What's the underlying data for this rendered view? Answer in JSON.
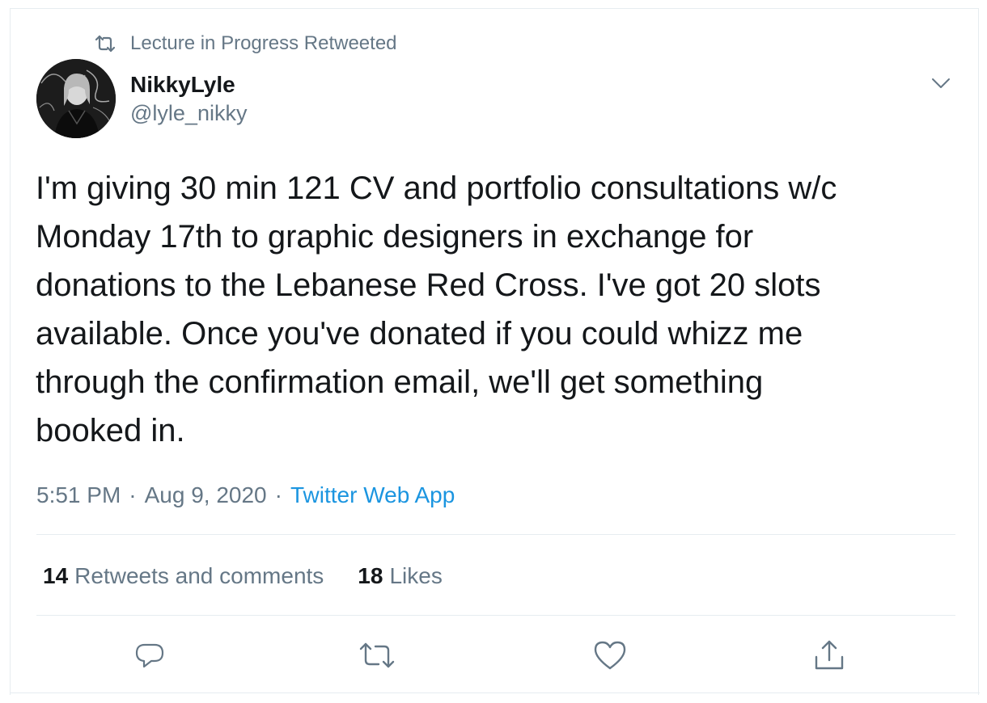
{
  "retweet_context": {
    "icon": "retweet-icon",
    "text": "Lecture in Progress Retweeted"
  },
  "author": {
    "display_name": "NikkyLyle",
    "handle": "@lyle_nikky",
    "avatar_icon": "avatar-photo"
  },
  "tweet": {
    "text": "I'm giving 30 min 121 CV and portfolio consultations w/c\nMonday 17th to graphic designers in exchange for\ndonations to the Lebanese Red Cross. I've got 20 slots\navailable. Once you've donated if you could whizz me\nthrough the confirmation email, we'll get something\nbooked in."
  },
  "meta": {
    "time": "5:51 PM",
    "separator": "·",
    "date": "Aug 9, 2020",
    "source": "Twitter Web App"
  },
  "stats": {
    "retweets_count": "14",
    "retweets_label": "Retweets and comments",
    "likes_count": "18",
    "likes_label": "Likes"
  },
  "actions": {
    "reply_icon": "reply-icon",
    "retweet_icon": "retweet-icon",
    "like_icon": "heart-icon",
    "share_icon": "share-icon"
  },
  "colors": {
    "text_primary": "#14171a",
    "text_secondary": "#657786",
    "link": "#1b95e0",
    "border": "#e6ecf0"
  }
}
